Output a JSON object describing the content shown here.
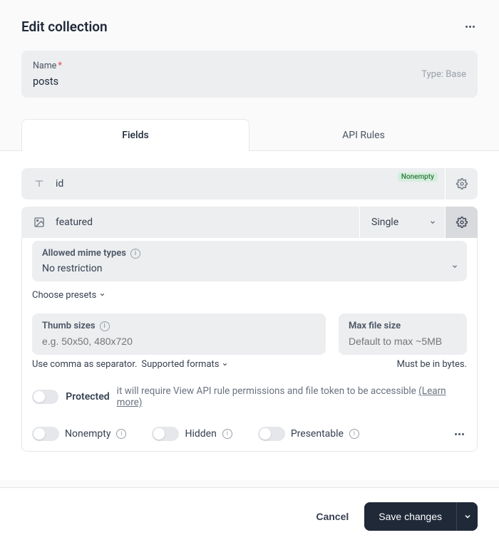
{
  "header": {
    "title": "Edit collection"
  },
  "name_block": {
    "label": "Name",
    "value": "posts",
    "type_text": "Type: Base"
  },
  "tabs": [
    {
      "label": "Fields",
      "active": true
    },
    {
      "label": "API Rules",
      "active": false
    }
  ],
  "fields": {
    "id": {
      "name": "id",
      "badge": "Nonempty"
    },
    "featured": {
      "name": "featured",
      "mode_selected": "Single"
    }
  },
  "expanded": {
    "mime": {
      "label": "Allowed mime types",
      "value": "No restriction"
    },
    "presets_link": "Choose presets",
    "thumb": {
      "label": "Thumb sizes",
      "placeholder": "e.g. 50x50, 480x720",
      "helper": "Use comma as separator.",
      "supported": "Supported formats"
    },
    "maxsize": {
      "label": "Max file size",
      "placeholder": "Default to max ~5MB",
      "helper": "Must be in bytes."
    },
    "protected": {
      "label": "Protected",
      "desc": "it will require View API rule permissions and file token to be accessible",
      "learn_more": "(Learn more)"
    },
    "flags": {
      "nonempty": "Nonempty",
      "hidden": "Hidden",
      "presentable": "Presentable"
    }
  },
  "footer": {
    "cancel": "Cancel",
    "save": "Save changes"
  }
}
